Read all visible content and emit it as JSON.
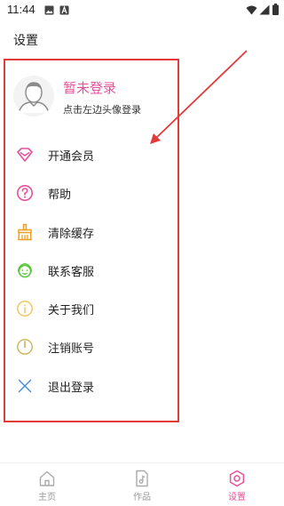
{
  "status_bar": {
    "time": "11:44"
  },
  "page_title": "设置",
  "profile": {
    "name": "暂未登录",
    "hint": "点击左边头像登录"
  },
  "menu": [
    {
      "label": "开通会员",
      "icon": "diamond-icon"
    },
    {
      "label": "帮助",
      "icon": "help-icon"
    },
    {
      "label": "清除缓存",
      "icon": "broom-icon"
    },
    {
      "label": "联系客服",
      "icon": "customer-service-icon"
    },
    {
      "label": "关于我们",
      "icon": "info-icon"
    },
    {
      "label": "注销账号",
      "icon": "power-icon"
    },
    {
      "label": "退出登录",
      "icon": "close-icon"
    }
  ],
  "bottom_nav": [
    {
      "label": "主页",
      "icon": "home-icon",
      "active": false
    },
    {
      "label": "作品",
      "icon": "music-file-icon",
      "active": false
    },
    {
      "label": "设置",
      "icon": "settings-icon",
      "active": true
    }
  ],
  "colors": {
    "accent": "#e9509a",
    "annotation": "#e33a3a"
  }
}
